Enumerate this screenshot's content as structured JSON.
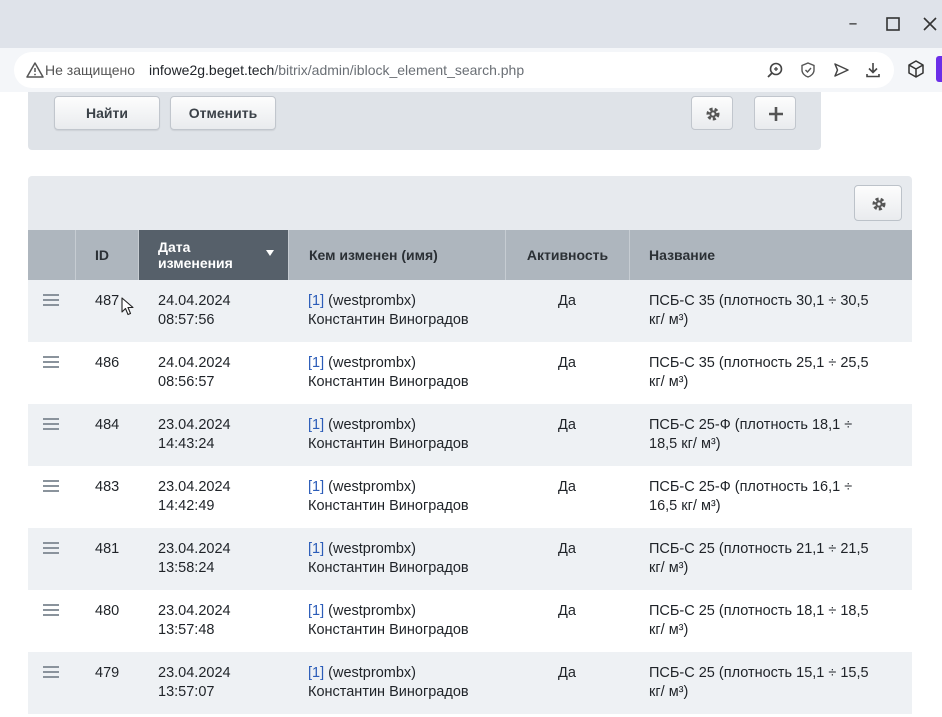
{
  "browser": {
    "secure_label": "Не защищено",
    "url_host": "infowe2g.beget.tech",
    "url_path": "/bitrix/admin/iblock_element_search.php",
    "window_controls": [
      "minimize",
      "maximize",
      "close"
    ],
    "toolbar_icons": [
      "search-icon",
      "shield-icon",
      "send-icon",
      "download-icon",
      "extension-icon"
    ]
  },
  "filter": {
    "find_label": "Найти",
    "cancel_label": "Отменить"
  },
  "table": {
    "columns": {
      "id": "ID",
      "date": "Дата изменения",
      "modified_by": "Кем изменен (имя)",
      "active": "Активность",
      "name": "Название"
    },
    "rows": [
      {
        "id": "487",
        "date": "24.04.2024",
        "time": "08:57:56",
        "user_link": "[1]",
        "user_login": "(westprombx)",
        "user_name": "Константин Виноградов",
        "active": "Да",
        "name_line1": "ПСБ-С 35 (плотность 30,1 ÷ 30,5",
        "name_line2": "кг/ м³)"
      },
      {
        "id": "486",
        "date": "24.04.2024",
        "time": "08:56:57",
        "user_link": "[1]",
        "user_login": "(westprombx)",
        "user_name": "Константин Виноградов",
        "active": "Да",
        "name_line1": "ПСБ-С 35 (плотность 25,1 ÷ 25,5",
        "name_line2": "кг/ м³)"
      },
      {
        "id": "484",
        "date": "23.04.2024",
        "time": "14:43:24",
        "user_link": "[1]",
        "user_login": "(westprombx)",
        "user_name": "Константин Виноградов",
        "active": "Да",
        "name_line1": "ПСБ-С 25-Ф (плотность 18,1 ÷",
        "name_line2": "18,5 кг/ м³)"
      },
      {
        "id": "483",
        "date": "23.04.2024",
        "time": "14:42:49",
        "user_link": "[1]",
        "user_login": "(westprombx)",
        "user_name": "Константин Виноградов",
        "active": "Да",
        "name_line1": "ПСБ-С 25-Ф (плотность 16,1 ÷",
        "name_line2": "16,5 кг/ м³)"
      },
      {
        "id": "481",
        "date": "23.04.2024",
        "time": "13:58:24",
        "user_link": "[1]",
        "user_login": "(westprombx)",
        "user_name": "Константин Виноградов",
        "active": "Да",
        "name_line1": "ПСБ-С 25 (плотность 21,1 ÷ 21,5",
        "name_line2": "кг/ м³)"
      },
      {
        "id": "480",
        "date": "23.04.2024",
        "time": "13:57:48",
        "user_link": "[1]",
        "user_login": "(westprombx)",
        "user_name": "Константин Виноградов",
        "active": "Да",
        "name_line1": "ПСБ-С 25 (плотность 18,1 ÷ 18,5",
        "name_line2": "кг/ м³)"
      },
      {
        "id": "479",
        "date": "23.04.2024",
        "time": "13:57:07",
        "user_link": "[1]",
        "user_login": "(westprombx)",
        "user_name": "Константин Виноградов",
        "active": "Да",
        "name_line1": "ПСБ-С 25 (плотность 15,1 ÷ 15,5",
        "name_line2": "кг/ м³)"
      }
    ]
  },
  "colors": {
    "sorted_header": "#56606a",
    "header": "#aeb6be",
    "row_alt": "#eef1f4",
    "link": "#2b5cb8",
    "extension_accent": "#6b2ee8"
  }
}
